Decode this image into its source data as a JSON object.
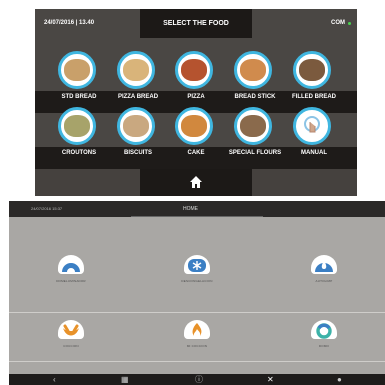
{
  "top_screen": {
    "datetime": "24/07/2016 | 13.40",
    "title": "SELECT THE FOOD",
    "status": "COM",
    "foods": [
      {
        "label": "STD BREAD",
        "icon": "bread-roll-icon",
        "color": "#c9a06a"
      },
      {
        "label": "PIZZA BREAD",
        "icon": "pizza-bread-icon",
        "color": "#d9b47a"
      },
      {
        "label": "PIZZA",
        "icon": "pizza-icon",
        "color": "#b5532f"
      },
      {
        "label": "BREAD STICK",
        "icon": "bread-stick-icon",
        "color": "#d08b4d"
      },
      {
        "label": "FILLED BREAD",
        "icon": "filled-bread-icon",
        "color": "#7b5a3e"
      },
      {
        "label": "CROUTONS",
        "icon": "croutons-icon",
        "color": "#a7a36a"
      },
      {
        "label": "BISCUITS",
        "icon": "biscuits-icon",
        "color": "#c9a880"
      },
      {
        "label": "CAKE",
        "icon": "cake-icon",
        "color": "#d1883e"
      },
      {
        "label": "SPECIAL FLOURS",
        "icon": "special-flours-icon",
        "color": "#8a6a4c"
      },
      {
        "label": "MANUAL",
        "icon": "manual-icon",
        "color": "#8cc4e6"
      }
    ]
  },
  "bottom_screen": {
    "datetime": "24/07/2016  15:37",
    "title": "HOME",
    "functions": [
      {
        "caption": "DOMELUMINADOR",
        "icon": "proof-icon",
        "color": "#3b7fc4"
      },
      {
        "caption": "DESCONGELACION",
        "icon": "snowflake-icon",
        "color": "#3b7fc4"
      },
      {
        "caption": "AUTOLIMP",
        "icon": "water-drop-icon",
        "color": "#3b7fc4"
      },
      {
        "caption": "COCCION",
        "icon": "croissant-icon",
        "color": "#e8922a"
      },
      {
        "caption": "MI COCCION",
        "icon": "flame-icon",
        "color": "#e8922a"
      },
      {
        "caption": "DOMO",
        "icon": "ring-icon",
        "color": "#3cb2a8"
      }
    ],
    "footer": [
      "back-icon",
      "grid-icon",
      "info-icon",
      "tools-icon",
      "user-icon"
    ]
  }
}
